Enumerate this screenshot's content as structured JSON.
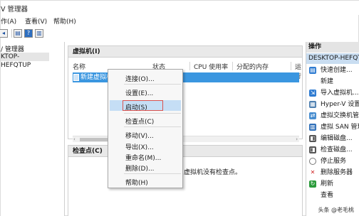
{
  "window": {
    "title": "V 管理器"
  },
  "menu": {
    "items": [
      "作(A)",
      "查看(V)",
      "帮助(H)"
    ]
  },
  "tree": {
    "root": "/ 管理器",
    "node": "KTOP-HEFQTUP"
  },
  "vm_panel": {
    "title": "虚拟机(I)",
    "columns": [
      "名称",
      "状态",
      "CPU 使用率",
      "分配的内存",
      "运行"
    ],
    "row": {
      "name": "新建虚拟机"
    }
  },
  "checkpoint_panel": {
    "title": "检查点(C)",
    "empty_text": "虚拟机没有检查点。"
  },
  "context_menu": {
    "items": [
      "连接(O)...",
      "设置(E)...",
      "启动(S)",
      "检查点(C)",
      "移动(V)...",
      "导出(X)...",
      "重命名(M)...",
      "删除(D)...",
      "帮助(H)"
    ],
    "highlighted": "启动(S)"
  },
  "actions": {
    "title": "操作",
    "host": "DESKTOP-HEFQT",
    "items": [
      {
        "label": "快速创建...",
        "icon": "quick-create-icon",
        "color": "#2e7bd1"
      },
      {
        "label": "新建",
        "icon": "new-icon",
        "color": "#ffffff"
      },
      {
        "label": "导入虚拟机...",
        "icon": "import-icon",
        "color": "#2e7bd1"
      },
      {
        "label": "Hyper-V 设置",
        "icon": "settings-icon",
        "color": "#4f80b0"
      },
      {
        "label": "虚拟交换机管理",
        "icon": "switch-icon",
        "color": "#4a8fd0"
      },
      {
        "label": "虚拟 SAN 管理",
        "icon": "san-icon",
        "color": "#2f6fb8"
      },
      {
        "label": "编辑磁盘...",
        "icon": "edit-disk-icon",
        "color": "#555555"
      },
      {
        "label": "检查磁盘...",
        "icon": "inspect-disk-icon",
        "color": "#555555"
      },
      {
        "label": "停止服务",
        "icon": "stop-icon",
        "color": "#ffffff"
      },
      {
        "label": "删除服务器",
        "icon": "delete-icon",
        "color": "#cc1f1f"
      },
      {
        "label": "刷新",
        "icon": "refresh-icon",
        "color": "#2a9a3a"
      },
      {
        "label": "查看",
        "icon": "view-icon",
        "color": "#ffffff"
      }
    ]
  },
  "watermark": "头条 @老毛桃"
}
